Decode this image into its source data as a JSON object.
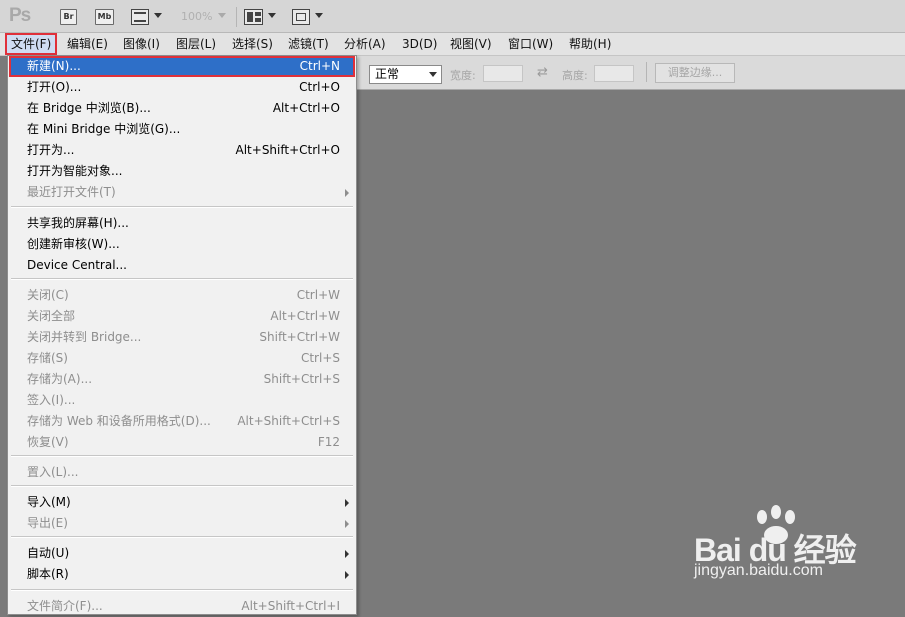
{
  "appbar": {
    "logo": "Ps",
    "bridge_btn": "Br",
    "minibridge_btn": "Mb",
    "zoom": "100%"
  },
  "menubar": {
    "items": [
      "文件(F)",
      "编辑(E)",
      "图像(I)",
      "图层(L)",
      "选择(S)",
      "滤镜(T)",
      "分析(A)",
      "3D(D)",
      "视图(V)",
      "窗口(W)",
      "帮助(H)"
    ],
    "active_index": 0
  },
  "options": {
    "style_value": "正常",
    "width_label": "宽度:",
    "height_label": "高度:",
    "refine_edge": "调整边缘..."
  },
  "file_menu": [
    {
      "label": "新建(N)...",
      "shortcut": "Ctrl+N",
      "highlighted": true
    },
    {
      "label": "打开(O)...",
      "shortcut": "Ctrl+O"
    },
    {
      "label": "在 Bridge 中浏览(B)...",
      "shortcut": "Alt+Ctrl+O"
    },
    {
      "label": "在 Mini Bridge 中浏览(G)...",
      "shortcut": ""
    },
    {
      "label": "打开为...",
      "shortcut": "Alt+Shift+Ctrl+O"
    },
    {
      "label": "打开为智能对象...",
      "shortcut": ""
    },
    {
      "label": "最近打开文件(T)",
      "shortcut": "",
      "submenu": true,
      "disabled": true
    },
    {
      "label": "共享我的屏幕(H)...",
      "shortcut": ""
    },
    {
      "label": "创建新审核(W)...",
      "shortcut": ""
    },
    {
      "label": "Device Central...",
      "shortcut": ""
    },
    {
      "label": "关闭(C)",
      "shortcut": "Ctrl+W",
      "disabled": true
    },
    {
      "label": "关闭全部",
      "shortcut": "Alt+Ctrl+W",
      "disabled": true
    },
    {
      "label": "关闭并转到 Bridge...",
      "shortcut": "Shift+Ctrl+W",
      "disabled": true
    },
    {
      "label": "存储(S)",
      "shortcut": "Ctrl+S",
      "disabled": true
    },
    {
      "label": "存储为(A)...",
      "shortcut": "Shift+Ctrl+S",
      "disabled": true
    },
    {
      "label": "签入(I)...",
      "shortcut": "",
      "disabled": true
    },
    {
      "label": "存储为 Web 和设备所用格式(D)...",
      "shortcut": "Alt+Shift+Ctrl+S",
      "disabled": true
    },
    {
      "label": "恢复(V)",
      "shortcut": "F12",
      "disabled": true
    },
    {
      "label": "置入(L)...",
      "shortcut": "",
      "disabled": true
    },
    {
      "label": "导入(M)",
      "shortcut": "",
      "submenu": true
    },
    {
      "label": "导出(E)",
      "shortcut": "",
      "submenu": true,
      "disabled": true
    },
    {
      "label": "自动(U)",
      "shortcut": "",
      "submenu": true
    },
    {
      "label": "脚本(R)",
      "shortcut": "",
      "submenu": true
    },
    {
      "label": "文件简介(F)...",
      "shortcut": "Alt+Shift+Ctrl+I",
      "disabled": true
    }
  ],
  "watermark": {
    "brand": "Bai du 经验",
    "url": "jingyan.baidu.com"
  },
  "colors": {
    "highlight": "#2e6fc8",
    "annotation_red": "#e0303a",
    "canvas": "#7a7a7a"
  }
}
